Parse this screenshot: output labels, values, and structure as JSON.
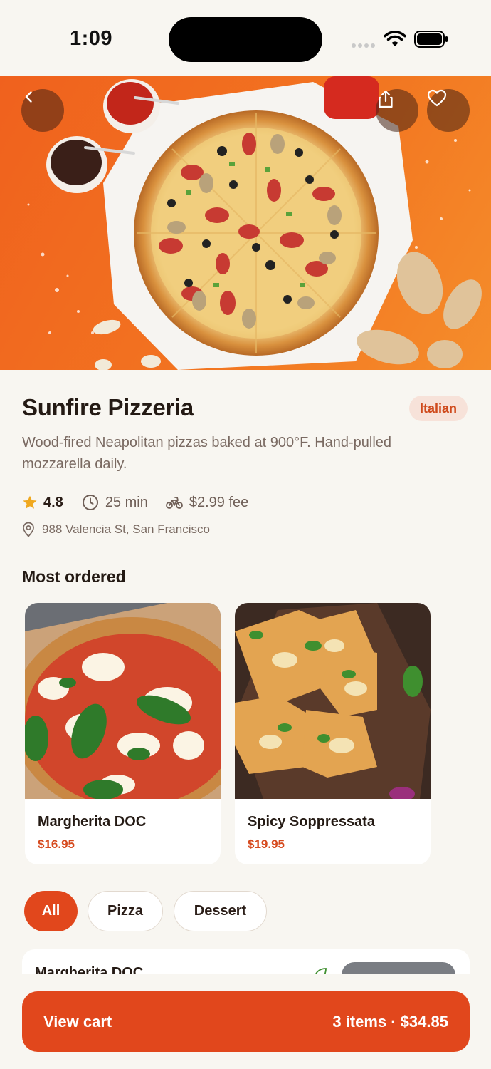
{
  "status": {
    "time": "1:09"
  },
  "restaurant": {
    "name": "Sunfire Pizzeria",
    "cuisine": "Italian",
    "description": "Wood-fired Neapolitan pizzas baked at 900°F. Hand-pulled mozzarella daily.",
    "rating": "4.8",
    "delivery_time": "25 min",
    "fee": "$2.99 fee",
    "address": "988 Valencia St, San Francisco"
  },
  "most_ordered": {
    "title": "Most ordered",
    "items": [
      {
        "name": "Margherita DOC",
        "price": "$16.95"
      },
      {
        "name": "Spicy Soppressata",
        "price": "$19.95"
      }
    ]
  },
  "filters": [
    {
      "label": "All",
      "active": true
    },
    {
      "label": "Pizza",
      "active": false
    },
    {
      "label": "Dessert",
      "active": false
    }
  ],
  "list_peek": {
    "name": "Margherita DOC"
  },
  "cart": {
    "label": "View cart",
    "summary": "3 items · $34.85"
  },
  "colors": {
    "accent": "#e1471c",
    "badge_bg": "#f7e2d9",
    "background": "#f8f6f1",
    "star": "#f0a81e"
  },
  "icons": [
    "back-icon",
    "share-icon",
    "heart-icon",
    "star-icon",
    "clock-icon",
    "bike-icon",
    "location-icon",
    "leaf-icon"
  ]
}
